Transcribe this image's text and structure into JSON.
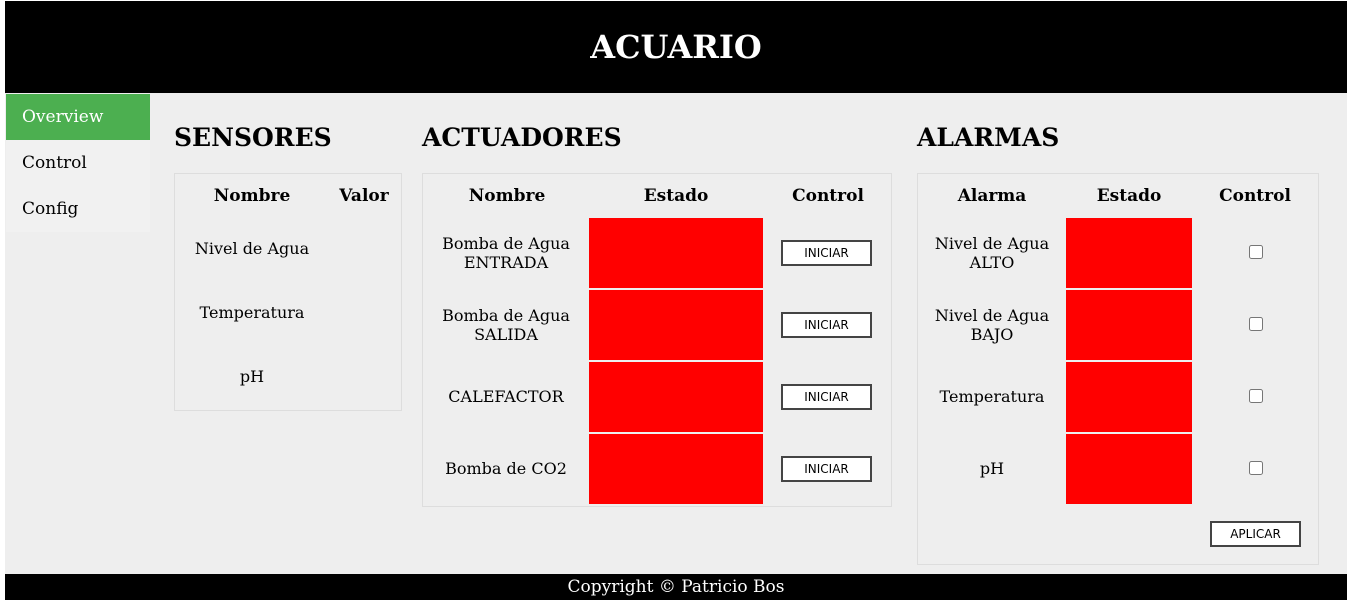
{
  "header": {
    "title": "ACUARIO"
  },
  "sidebar": {
    "items": [
      {
        "label": "Overview",
        "active": true
      },
      {
        "label": "Control",
        "active": false
      },
      {
        "label": "Config",
        "active": false
      }
    ]
  },
  "sensores": {
    "title": "SENSORES",
    "columns": [
      "Nombre",
      "Valor"
    ],
    "rows": [
      {
        "name": "Nivel de Agua",
        "value": ""
      },
      {
        "name": "Temperatura",
        "value": ""
      },
      {
        "name": "pH",
        "value": ""
      }
    ]
  },
  "actuadores": {
    "title": "ACTUADORES",
    "columns": [
      "Nombre",
      "Estado",
      "Control"
    ],
    "rows": [
      {
        "name_line1": "Bomba de Agua",
        "name_line2": "ENTRADA",
        "state_color": "#ff0000",
        "button": "INICIAR"
      },
      {
        "name_line1": "Bomba de Agua",
        "name_line2": "SALIDA",
        "state_color": "#ff0000",
        "button": "INICIAR"
      },
      {
        "name_line1": "CALEFACTOR",
        "name_line2": "",
        "state_color": "#ff0000",
        "button": "INICIAR"
      },
      {
        "name_line1": "Bomba de CO2",
        "name_line2": "",
        "state_color": "#ff0000",
        "button": "INICIAR"
      }
    ]
  },
  "alarmas": {
    "title": "ALARMAS",
    "columns": [
      "Alarma",
      "Estado",
      "Control"
    ],
    "rows": [
      {
        "name_line1": "Nivel de Agua",
        "name_line2": "ALTO",
        "state_color": "#ff0000",
        "checked": false
      },
      {
        "name_line1": "Nivel de Agua",
        "name_line2": "BAJO",
        "state_color": "#ff0000",
        "checked": false
      },
      {
        "name_line1": "Temperatura",
        "name_line2": "",
        "state_color": "#ff0000",
        "checked": false
      },
      {
        "name_line1": "pH",
        "name_line2": "",
        "state_color": "#ff0000",
        "checked": false
      }
    ],
    "apply_button": "APLICAR"
  },
  "footer": {
    "text": "Copyright © Patricio Bos"
  },
  "colors": {
    "header_bg": "#000000",
    "active_nav": "#4caf50",
    "state_off": "#ff0000",
    "content_bg": "#eeeeee"
  }
}
